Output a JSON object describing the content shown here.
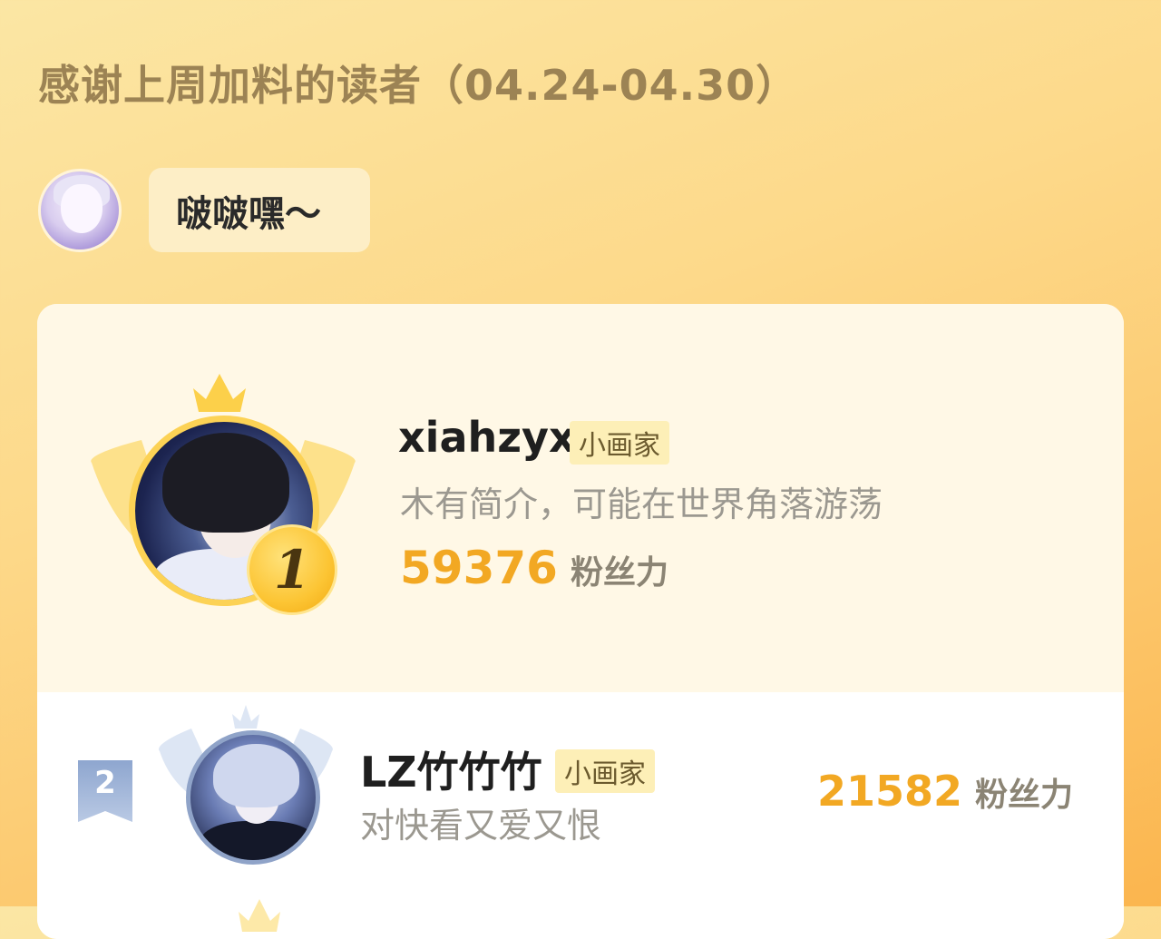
{
  "header": {
    "title": "感谢上周加料的读者（04.24-04.30）"
  },
  "message": {
    "text": "啵啵嘿～"
  },
  "leaderboard": [
    {
      "rank": "1",
      "name": "xiahzyx",
      "badge": "小画家",
      "bio": "木有简介，可能在世界角落游荡",
      "score": "59376",
      "score_unit": "粉丝力"
    },
    {
      "rank": "2",
      "name": "LZ竹竹竹",
      "badge": "小画家",
      "bio": "对快看又爱又恨",
      "score": "21582",
      "score_unit": "粉丝力"
    }
  ],
  "colors": {
    "accent": "#f2a823",
    "badge_bg": "#fdefb7",
    "title": "#9c8354"
  }
}
